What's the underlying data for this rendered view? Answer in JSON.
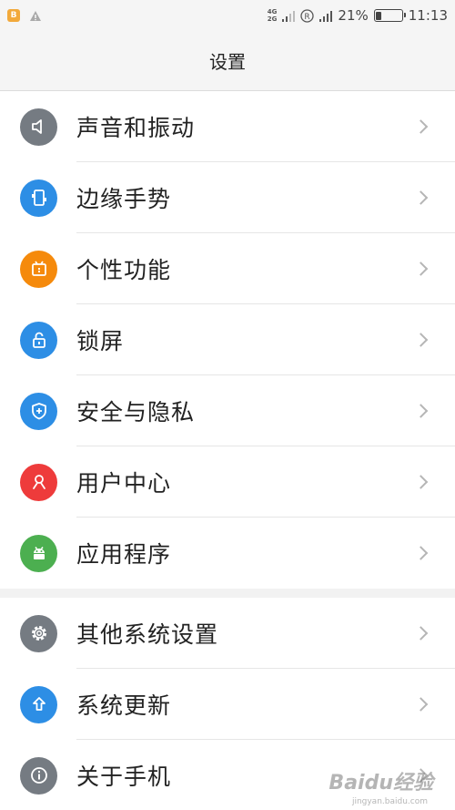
{
  "status_bar": {
    "network_type": [
      "4G",
      "2G"
    ],
    "battery_percent": "21%",
    "battery_level": 0.21,
    "time": "11:13"
  },
  "header": {
    "title": "设置"
  },
  "sections": [
    {
      "items": [
        {
          "label": "声音和振动",
          "icon": "speaker-icon",
          "color": "#757b82"
        },
        {
          "label": "边缘手势",
          "icon": "edge-gesture-icon",
          "color": "#2d8ee5"
        },
        {
          "label": "个性功能",
          "icon": "personal-feature-icon",
          "color": "#f58a0c"
        },
        {
          "label": "锁屏",
          "icon": "lock-icon",
          "color": "#2d8ee5"
        },
        {
          "label": "安全与隐私",
          "icon": "shield-icon",
          "color": "#2d8ee5"
        },
        {
          "label": "用户中心",
          "icon": "user-icon",
          "color": "#ee3b3b"
        },
        {
          "label": "应用程序",
          "icon": "android-icon",
          "color": "#4caf50"
        }
      ]
    },
    {
      "items": [
        {
          "label": "其他系统设置",
          "icon": "gear-icon",
          "color": "#757b82"
        },
        {
          "label": "系统更新",
          "icon": "upload-arrow-icon",
          "color": "#2d8ee5"
        },
        {
          "label": "关于手机",
          "icon": "info-icon",
          "color": "#757b82"
        }
      ]
    }
  ],
  "watermark": {
    "text": "Baidu经验",
    "sub": "jingyan.baidu.com"
  }
}
